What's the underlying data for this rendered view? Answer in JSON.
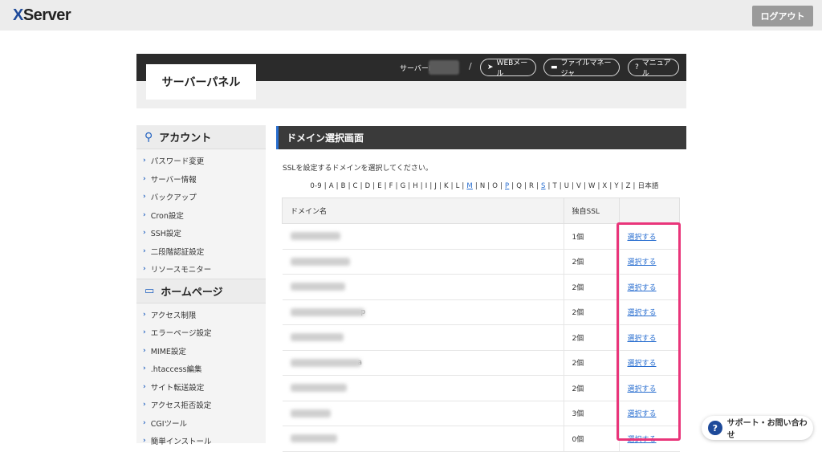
{
  "app": {
    "logo": "XServer",
    "logout_label": "ログアウト"
  },
  "panel": {
    "title": "サーバーパネル",
    "server_id_label": "サーバーID",
    "buttons": [
      {
        "label": "WEBメール",
        "icon": "paper-plane-icon"
      },
      {
        "label": "ファイルマネージャ",
        "icon": "folder-icon"
      },
      {
        "label": "マニュアル",
        "icon": "question-circle-icon"
      }
    ]
  },
  "sidebar": {
    "account_heading": "アカウント",
    "account_items": [
      "パスワード変更",
      "サーバー情報",
      "バックアップ",
      "Cron設定",
      "SSH設定",
      "二段階認証設定",
      "リソースモニター"
    ],
    "homepage_heading": "ホームページ",
    "homepage_items": [
      "アクセス制限",
      "エラーページ設定",
      "MIME設定",
      ".htaccess編集",
      "サイト転送設定",
      "アクセス拒否設定",
      "CGIツール",
      "簡単インストール"
    ]
  },
  "main": {
    "heading": "ドメイン選択画面",
    "description": "SSLを設定するドメインを選択してください。",
    "alpha_index": [
      "0-9",
      "A",
      "B",
      "C",
      "D",
      "E",
      "F",
      "G",
      "H",
      "I",
      "J",
      "K",
      "L",
      "M",
      "N",
      "O",
      "P",
      "Q",
      "R",
      "S",
      "T",
      "U",
      "V",
      "W",
      "X",
      "Y",
      "Z",
      "日本語"
    ],
    "alpha_links": [
      "M",
      "P",
      "S"
    ],
    "table": {
      "headers": [
        "ドメイン名",
        "独自SSL",
        ""
      ],
      "rows": [
        {
          "tail": "",
          "ssl": "1個",
          "action": "選択する"
        },
        {
          "tail": "",
          "ssl": "2個",
          "action": "選択する"
        },
        {
          "tail": "",
          "ssl": "2個",
          "action": "選択する"
        },
        {
          "tail": "p",
          "ssl": "2個",
          "action": "選択する"
        },
        {
          "tail": "",
          "ssl": "2個",
          "action": "選択する"
        },
        {
          "tail": "a",
          "ssl": "2個",
          "action": "選択する"
        },
        {
          "tail": "",
          "ssl": "2個",
          "action": "選択する"
        },
        {
          "tail": "",
          "ssl": "3個",
          "action": "選択する"
        },
        {
          "tail": "",
          "ssl": "0個",
          "action": "選択する"
        }
      ]
    }
  },
  "support": {
    "label": "サポート・お問い合わせ"
  },
  "colors": {
    "accent": "#2a6fd0",
    "highlight": "#e9357a",
    "dark": "#2b2b2b"
  }
}
